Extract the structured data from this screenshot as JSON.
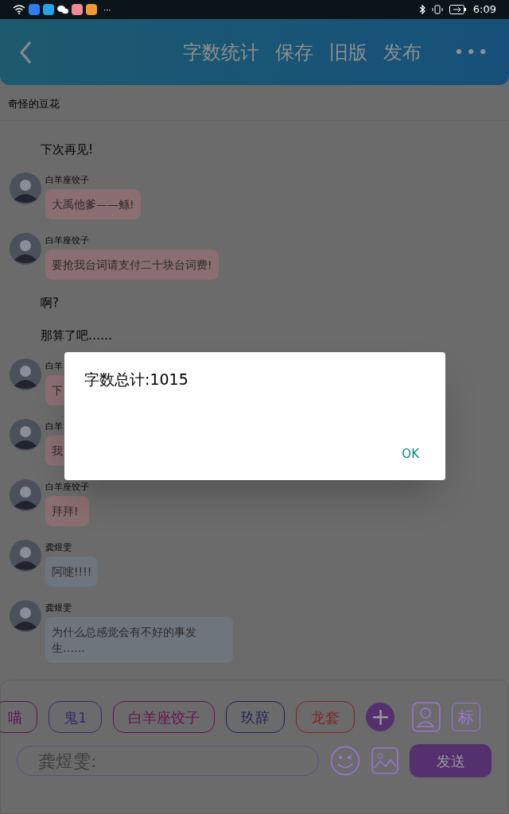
{
  "status_bar": {
    "more": "···",
    "time": "6:09"
  },
  "header": {
    "actions": [
      {
        "label": "字数统计"
      },
      {
        "label": "保存"
      },
      {
        "label": "旧版"
      },
      {
        "label": "发布"
      }
    ],
    "more": "•••"
  },
  "title": "奇怪的豆花",
  "messages": [
    {
      "kind": "narration",
      "text": "下次再见!"
    },
    {
      "kind": "bubble",
      "sender": "白羊座饺子",
      "text": "大禹他爹——鲧!",
      "color": "#8a6e72"
    },
    {
      "kind": "bubble",
      "sender": "白羊座饺子",
      "text": "要抢我台词请支付二十块台词费!",
      "color": "#8a6e72"
    },
    {
      "kind": "narration",
      "text": "啊?"
    },
    {
      "kind": "narration",
      "text": "那算了吧……"
    },
    {
      "kind": "bubble",
      "sender": "白羊",
      "text": "下",
      "color": "#8a6e72"
    },
    {
      "kind": "bubble",
      "sender": "白羊",
      "text": "我",
      "color": "#8a6e72"
    },
    {
      "kind": "bubble",
      "sender": "白羊座饺子",
      "text": "拜拜!",
      "color": "#8a6e72"
    },
    {
      "kind": "bubble",
      "sender": "龚煜雯",
      "text": "阿嚏!!!!",
      "color": "#6f757d"
    },
    {
      "kind": "bubble",
      "sender": "龚煜雯",
      "text": "为什么总感觉会有不好的事发生……",
      "color": "#6f757d"
    }
  ],
  "roles": [
    {
      "label": "喵",
      "color": "#5e1058"
    },
    {
      "label": "鬼1",
      "color": "#3a2a70"
    },
    {
      "label": "白羊座饺子",
      "color": "#661050"
    },
    {
      "label": "玖辞",
      "color": "#1a2252"
    },
    {
      "label": "龙套",
      "color": "#802626"
    }
  ],
  "add_role": "+",
  "mark_button": "标",
  "input": {
    "placeholder": "龚煜雯:"
  },
  "send": "发送",
  "dialog": {
    "message": "字数总计:1015",
    "ok": "OK"
  }
}
